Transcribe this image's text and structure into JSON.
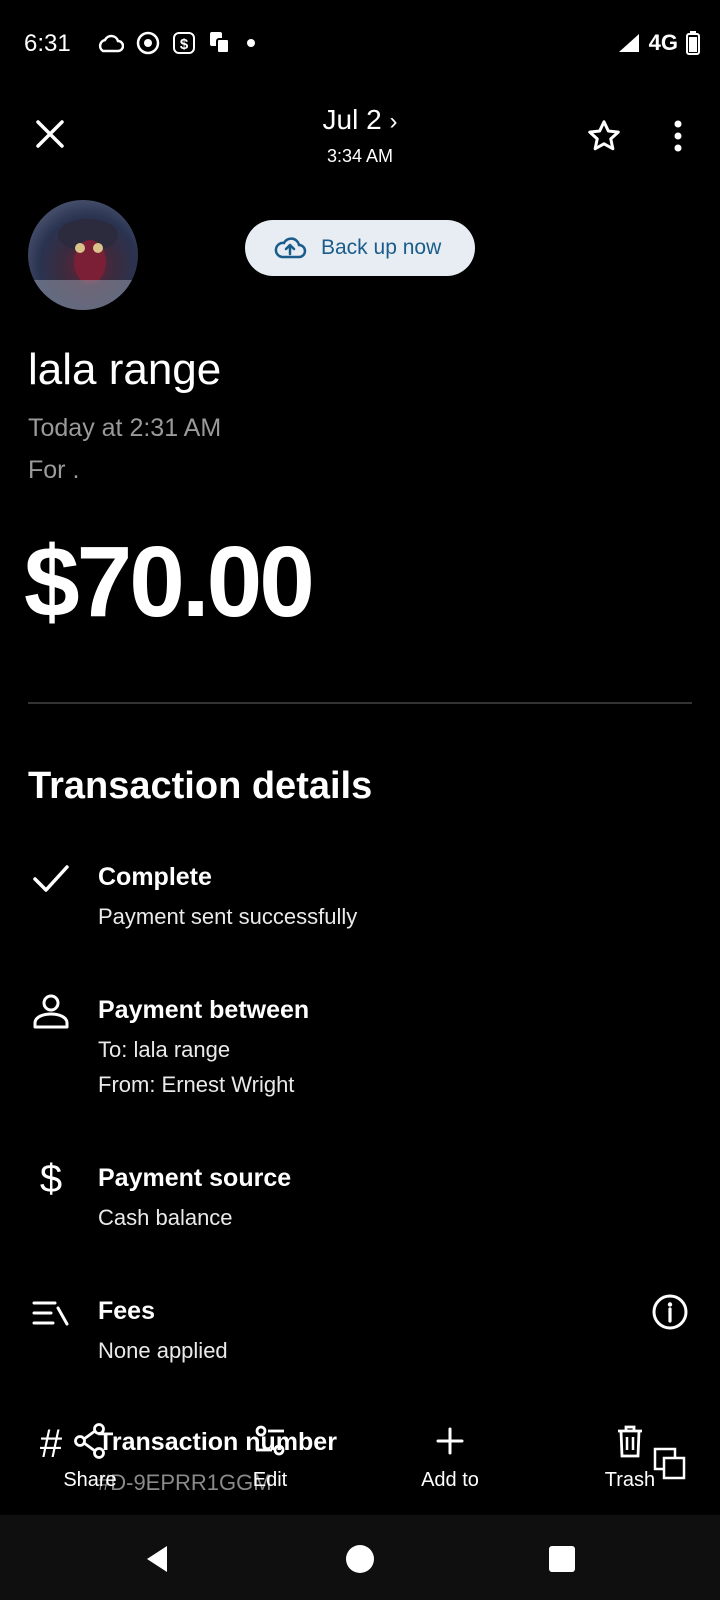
{
  "status_bar": {
    "time": "6:31",
    "network": "4G"
  },
  "header": {
    "date": "Jul 2",
    "time": "3:34 AM",
    "backup_label": "Back up now"
  },
  "recipient": {
    "name": "lala range",
    "timestamp": "Today at 2:31 AM",
    "note": "For ."
  },
  "amount": "$70.00",
  "details": {
    "title": "Transaction details",
    "status": {
      "title": "Complete",
      "subtitle": "Payment sent successfully"
    },
    "between": {
      "title": "Payment between",
      "to": "To: lala range",
      "from": "From: Ernest Wright"
    },
    "source": {
      "title": "Payment source",
      "value": "Cash balance"
    },
    "fees": {
      "title": "Fees",
      "value": "None applied"
    },
    "number": {
      "title": "Transaction number",
      "value": "#D-9EPRR1GGM"
    }
  },
  "actions": {
    "share": "Share",
    "edit": "Edit",
    "add_to": "Add to",
    "trash": "Trash"
  },
  "colors": {
    "background": "#000000",
    "backup_pill": "#e8edf3",
    "backup_text": "#1a5c8a"
  }
}
